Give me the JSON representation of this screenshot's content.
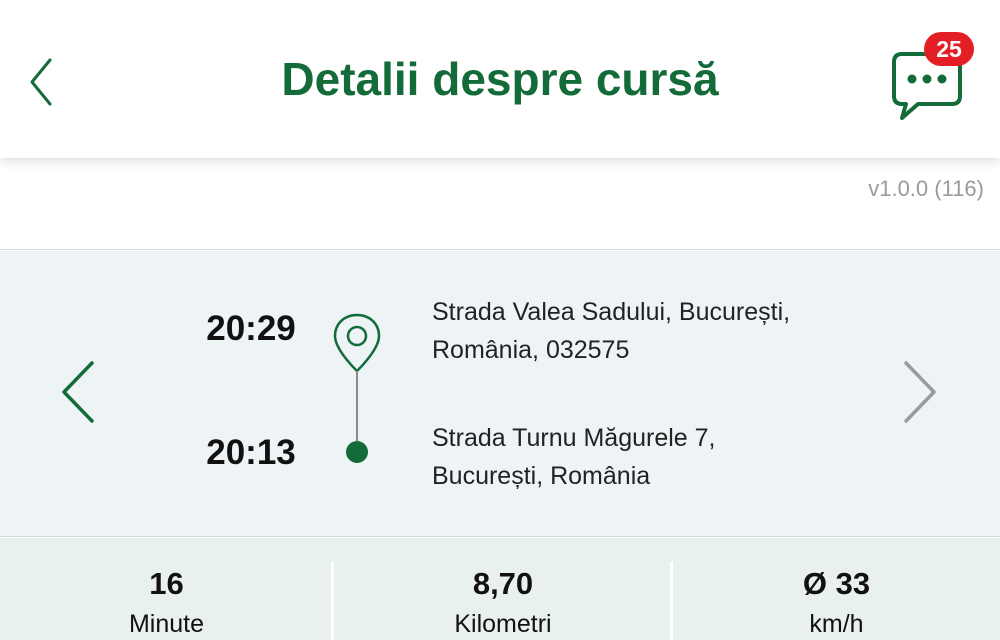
{
  "header": {
    "title": "Detalii despre cursă",
    "back_icon": "chevron-left-icon",
    "chat_icon": "chat-bubble-icon",
    "chat_badge": "25"
  },
  "version": "v1.0.0 (116)",
  "trip": {
    "start_time": "20:29",
    "end_time": "20:13",
    "start_address": [
      "Strada Valea Sadului, București,",
      "România, 032575"
    ],
    "end_address": [
      "Strada Turnu Măgurele 7,",
      "București, România"
    ],
    "prev_icon": "chevron-left-icon",
    "next_icon": "chevron-right-icon"
  },
  "stats": [
    {
      "value": "16",
      "label": "Minute"
    },
    {
      "value": "8,70",
      "label": "Kilometri"
    },
    {
      "value": "Ø 33",
      "label": "km/h"
    }
  ],
  "colors": {
    "brand_green": "#146b3a",
    "badge_red": "#e41e25",
    "next_disabled": "#9a9a9a"
  }
}
